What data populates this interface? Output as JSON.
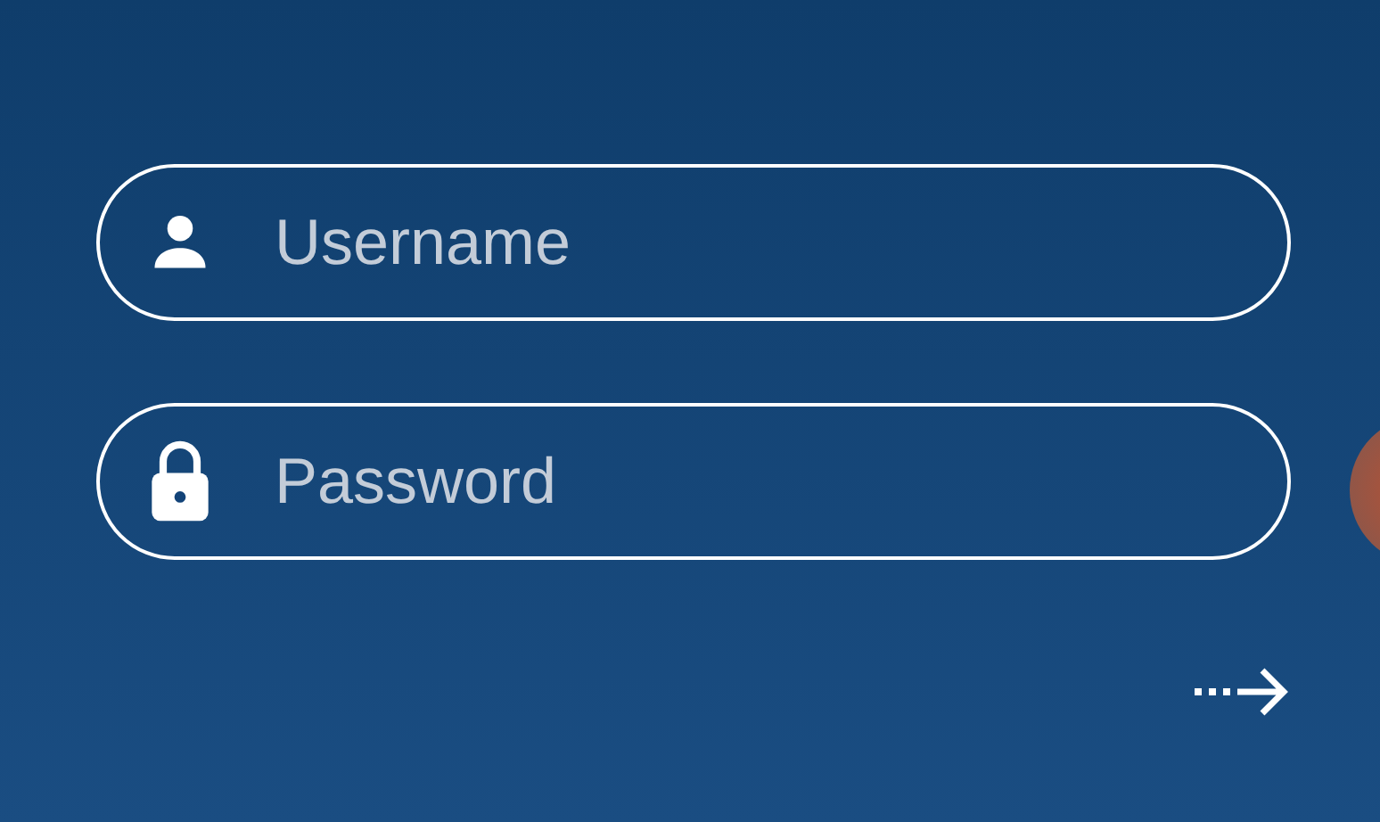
{
  "fields": [
    {
      "kind": "user",
      "placeholder": "Username"
    },
    {
      "kind": "password",
      "placeholder": "Password"
    }
  ]
}
